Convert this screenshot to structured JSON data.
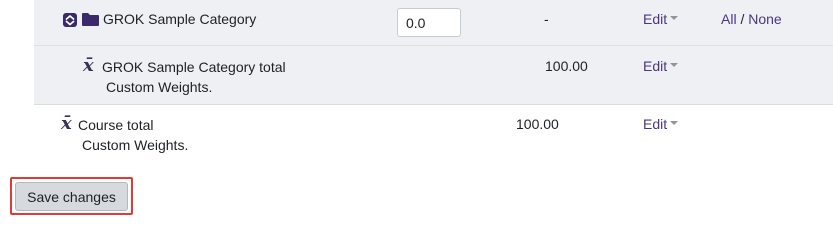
{
  "category_row": {
    "name": "GROK Sample Category",
    "weight_value": "0.0",
    "range": "-",
    "edit_label": "Edit",
    "select_all_label": "All",
    "separator": "/",
    "select_none_label": "None",
    "toggle_icon": "collapse-chevrons-icon",
    "folder_icon": "folder-icon"
  },
  "category_total_row": {
    "name": "GROK Sample Category total",
    "subtitle": "Custom Weights.",
    "max_grade": "100.00",
    "edit_label": "Edit",
    "icon": "mean-x-bar-icon",
    "icon_glyph": "x̄"
  },
  "course_total_row": {
    "name": "Course total",
    "subtitle": "Custom Weights.",
    "max_grade": "100.00",
    "edit_label": "Edit",
    "icon": "mean-x-bar-icon",
    "icon_glyph": "x̄"
  },
  "footer": {
    "save_label": "Save changes",
    "highlight_color": "#e53935"
  },
  "colors": {
    "link": "#4c3682",
    "folder": "#3b2a6b",
    "category_background": "#eef0f3"
  }
}
